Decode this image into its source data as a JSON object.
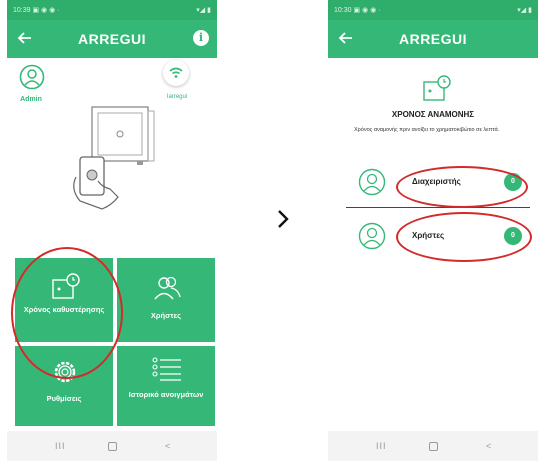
{
  "colors": {
    "accent": "#35b877",
    "highlight": "#d42a2a"
  },
  "left": {
    "brand": "ARREGUI",
    "admin_label": "Admin",
    "device_label": "Iarregui",
    "tiles": {
      "timer": "Χρόνος καθυστέρησης",
      "users": "Χρήστες",
      "settings": "Ρυθμίσεις",
      "history": "Ιστορικό ανοιγμάτων"
    },
    "icons": [
      "back-arrow-icon",
      "info-icon",
      "user-avatar-icon",
      "wifi-icon",
      "safe-phone-illustration",
      "timer-safe-icon",
      "users-icon",
      "gear-icon",
      "list-icon"
    ]
  },
  "right": {
    "brand": "ARREGUI",
    "title": "ΧΡΟΝΟΣ ΑΝΑΜΟΝΗΣ",
    "description": "Χρόνος αναμονής πριν ανοίξει το χρηματοκιβώτιο σε λεπτά.",
    "rows": [
      {
        "label": "Διαχειριστής",
        "count": "0"
      },
      {
        "label": "Χρήστες",
        "count": "0"
      }
    ]
  },
  "navbar": {
    "recent": "III",
    "back": "<"
  }
}
